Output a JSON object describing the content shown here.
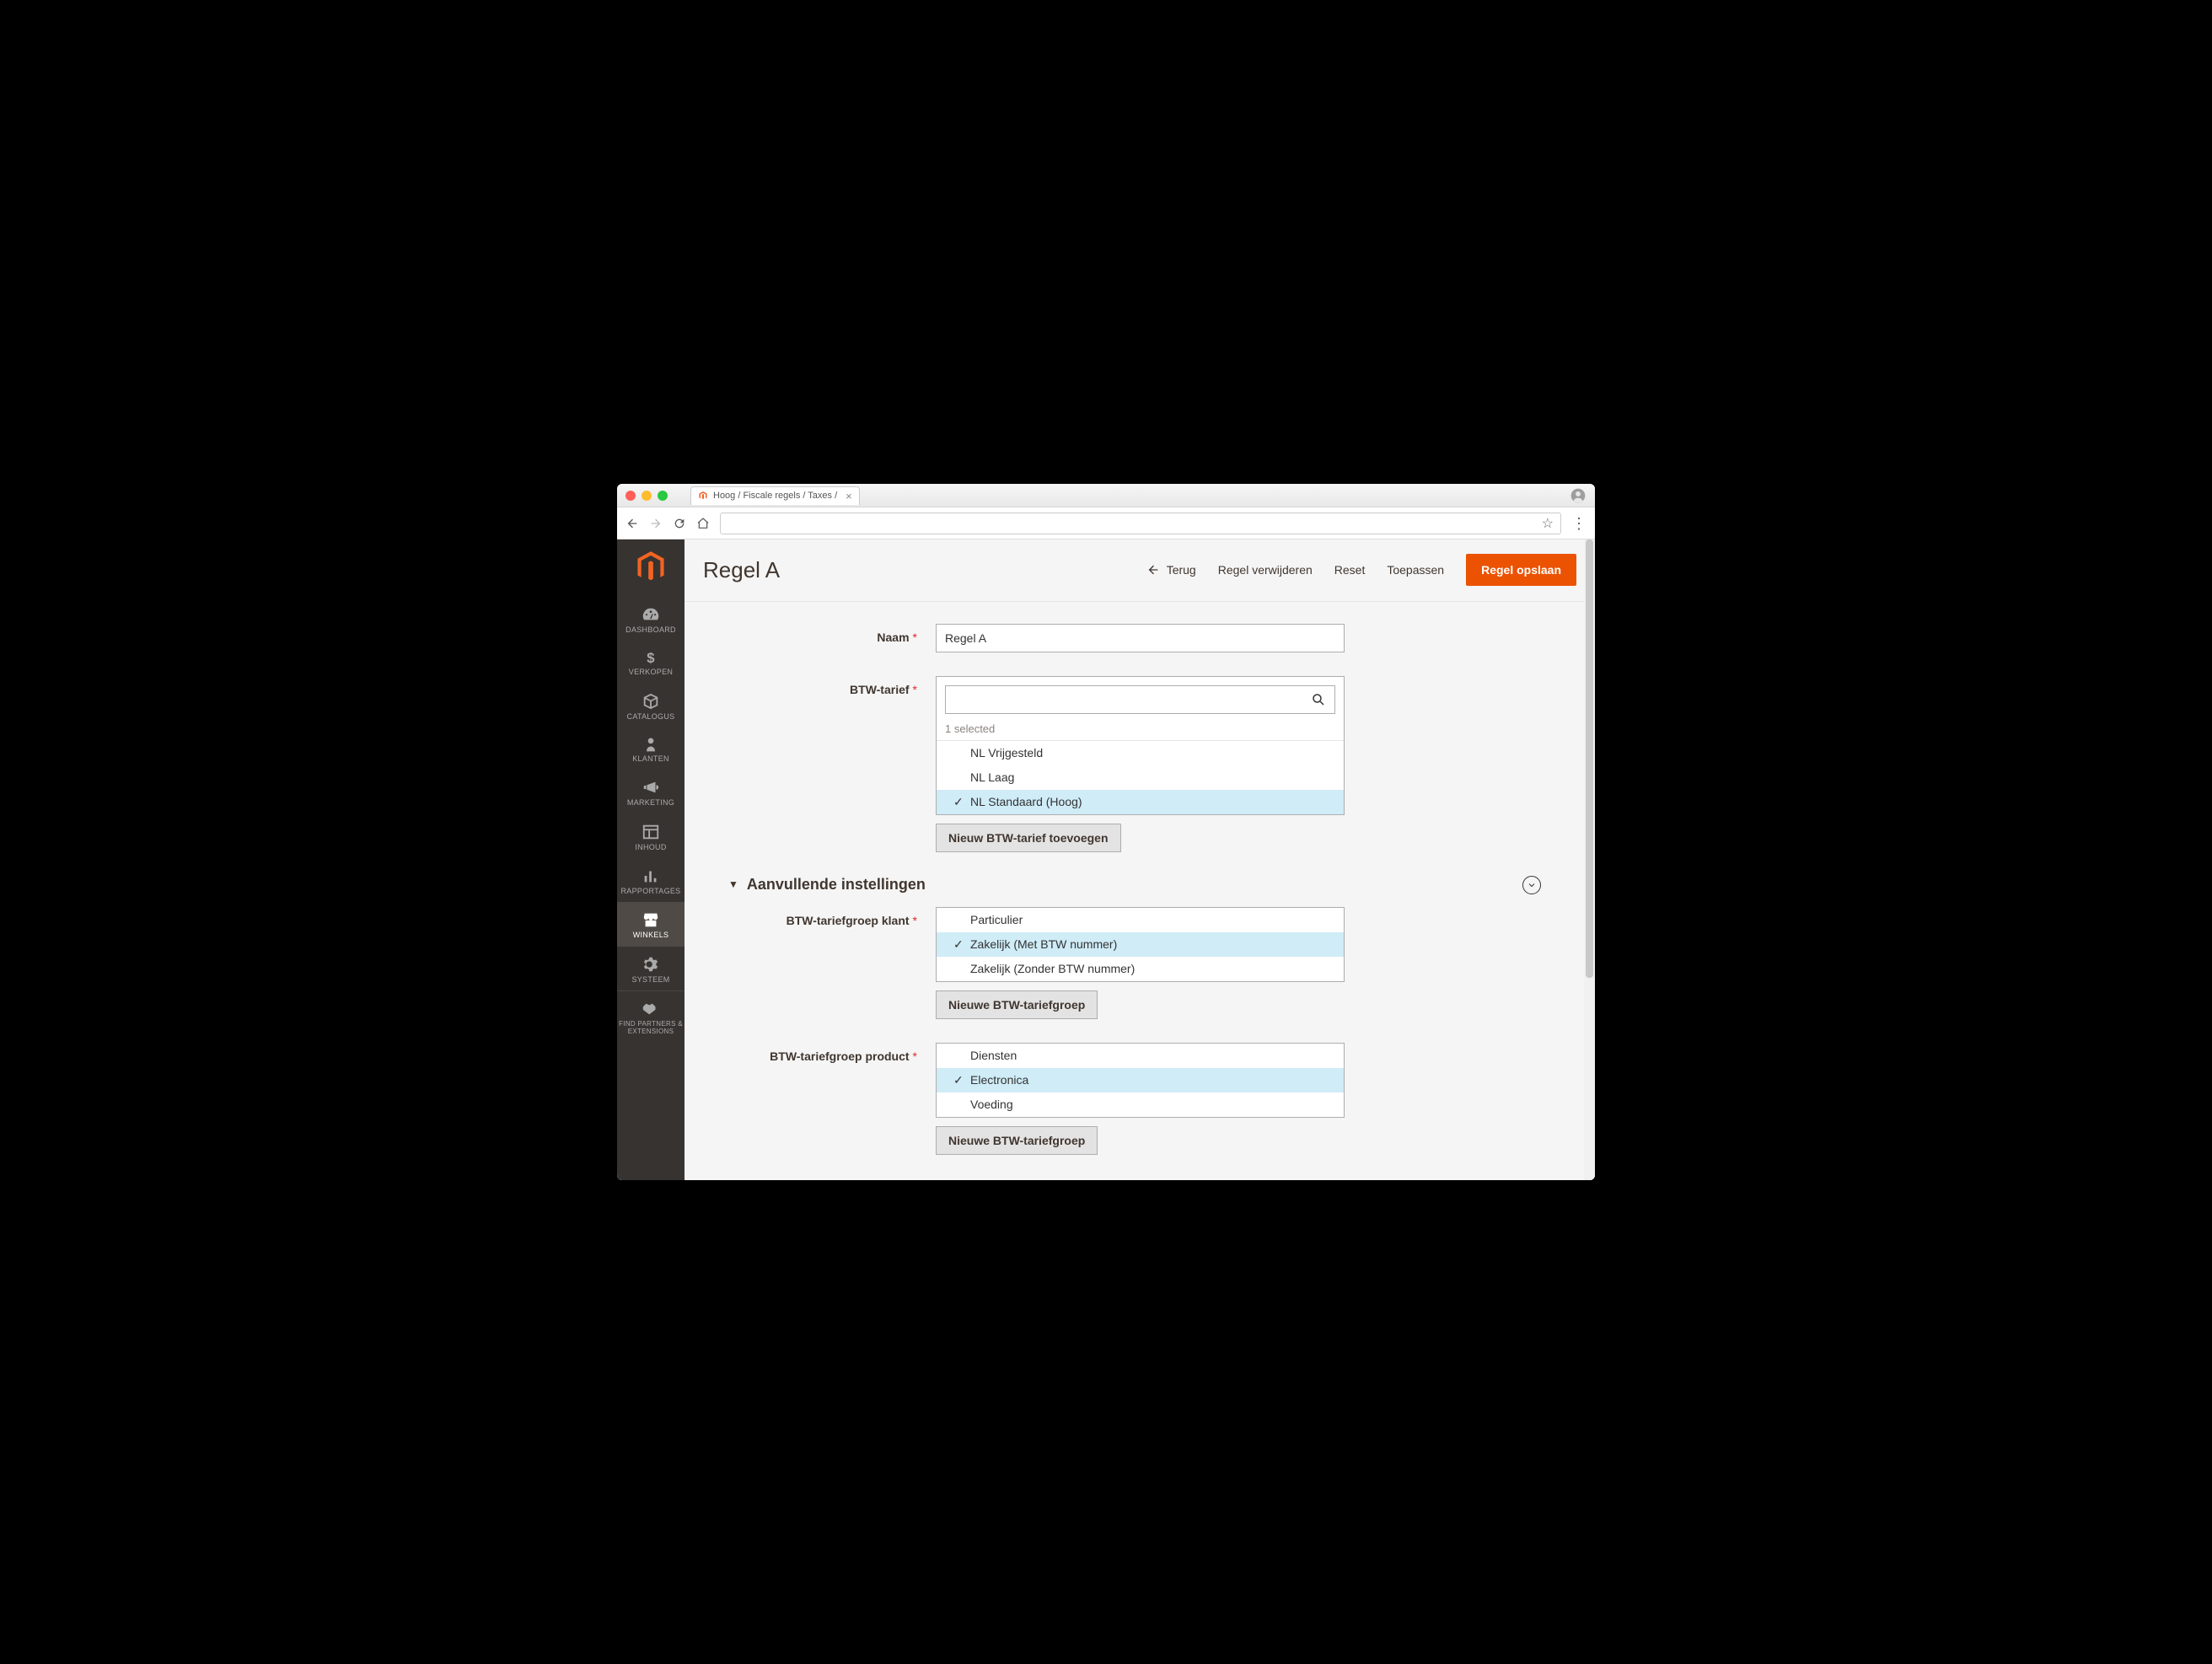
{
  "browser": {
    "tab_title": "Hoog / Fiscale regels / Taxes /"
  },
  "sidebar": {
    "items": [
      {
        "label": "DASHBOARD"
      },
      {
        "label": "VERKOPEN"
      },
      {
        "label": "CATALOGUS"
      },
      {
        "label": "KLANTEN"
      },
      {
        "label": "MARKETING"
      },
      {
        "label": "INHOUD"
      },
      {
        "label": "RAPPORTAGES"
      },
      {
        "label": "WINKELS"
      },
      {
        "label": "SYSTEEM"
      },
      {
        "label": "FIND PARTNERS & EXTENSIONS"
      }
    ]
  },
  "header": {
    "title": "Regel A",
    "back": "Terug",
    "delete": "Regel verwijderen",
    "reset": "Reset",
    "apply": "Toepassen",
    "save": "Regel opslaan"
  },
  "form": {
    "name": {
      "label": "Naam",
      "value": "Regel A"
    },
    "tax_rate": {
      "label": "BTW-tarief",
      "selected_count": "1 selected",
      "options": [
        {
          "label": "NL Vrijgesteld",
          "selected": false
        },
        {
          "label": "NL Laag",
          "selected": false
        },
        {
          "label": "NL Standaard (Hoog)",
          "selected": true
        }
      ],
      "add_button": "Nieuw BTW-tarief toevoegen"
    }
  },
  "section": {
    "title": "Aanvullende instellingen"
  },
  "customer_group": {
    "label": "BTW-tariefgroep klant",
    "options": [
      {
        "label": "Particulier",
        "selected": false
      },
      {
        "label": "Zakelijk (Met BTW nummer)",
        "selected": true
      },
      {
        "label": "Zakelijk (Zonder BTW nummer)",
        "selected": false
      }
    ],
    "add_button": "Nieuwe BTW-tariefgroep"
  },
  "product_group": {
    "label": "BTW-tariefgroep product",
    "options": [
      {
        "label": "Diensten",
        "selected": false
      },
      {
        "label": "Electronica",
        "selected": true
      },
      {
        "label": "Voeding",
        "selected": false
      }
    ],
    "add_button": "Nieuwe BTW-tariefgroep"
  }
}
